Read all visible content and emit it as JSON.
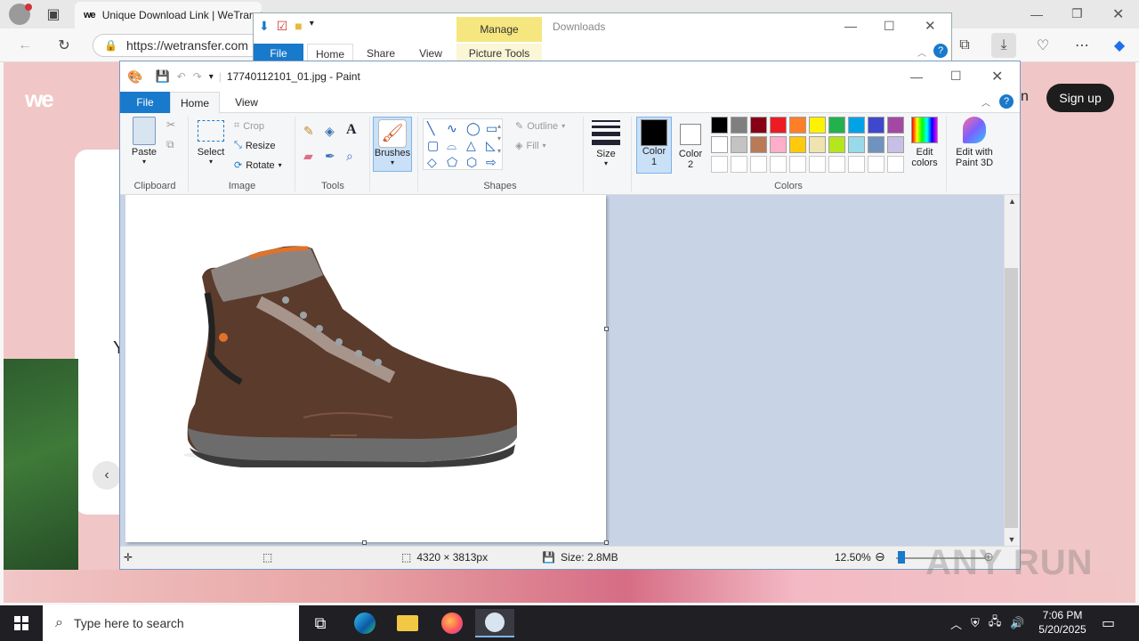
{
  "browser": {
    "tab_title": "Unique Download Link | WeTransfer",
    "tab_logo": "we",
    "url": "https://wetransfer.com",
    "icons": [
      "profile-icon",
      "tab-actions-icon",
      "back-icon",
      "refresh-icon",
      "lock-icon",
      "collections-icon",
      "downloads-icon",
      "health-icon",
      "more-icon",
      "copilot-icon"
    ]
  },
  "webpage": {
    "logo": "we",
    "signup_label": "Sign up",
    "partial_text_right": "n",
    "partial_text_left": "Y",
    "back_arrow": "‹"
  },
  "explorer": {
    "title": "Downloads",
    "manage_label": "Manage",
    "tabs": [
      "File",
      "Home",
      "Share",
      "View",
      "Picture Tools"
    ]
  },
  "paint": {
    "title": "17740112101_01.jpg - Paint",
    "tabs": {
      "file": "File",
      "home": "Home",
      "view": "View"
    },
    "clipboard": {
      "paste": "Paste",
      "label": "Clipboard"
    },
    "image": {
      "select": "Select",
      "crop": "Crop",
      "resize": "Resize",
      "rotate": "Rotate",
      "label": "Image"
    },
    "tools": {
      "label": "Tools"
    },
    "brushes": {
      "label": "Brushes"
    },
    "shapes": {
      "outline": "Outline",
      "fill": "Fill",
      "label": "Shapes"
    },
    "size": {
      "label": "Size"
    },
    "color1": {
      "label": "Color\n1",
      "line1": "Color",
      "line2": "1",
      "value": "#000000"
    },
    "color2": {
      "line1": "Color",
      "line2": "2",
      "value": "#ffffff"
    },
    "colors": {
      "label": "Colors",
      "row1": [
        "#000000",
        "#7f7f7f",
        "#880015",
        "#ed1c24",
        "#ff7f27",
        "#fff200",
        "#22b14c",
        "#00a2e8",
        "#3f48cc",
        "#a349a4"
      ],
      "row2": [
        "#ffffff",
        "#c3c3c3",
        "#b97a57",
        "#ffaec9",
        "#ffc90e",
        "#efe4b0",
        "#b5e61d",
        "#99d9ea",
        "#7092be",
        "#c8bfe7"
      ]
    },
    "edit_colors": {
      "line1": "Edit",
      "line2": "colors"
    },
    "edit_paint3d": {
      "line1": "Edit with",
      "line2": "Paint 3D"
    },
    "status": {
      "dimensions": "4320 × 3813px",
      "size": "Size: 2.8MB",
      "zoom": "12.50%"
    }
  },
  "taskbar": {
    "search_placeholder": "Type here to search",
    "apps": [
      "task-view-icon",
      "edge-icon",
      "file-explorer-icon",
      "firefox-icon",
      "paint-icon"
    ],
    "time": "7:06 PM",
    "date": "5/20/2025"
  },
  "watermark": "ANY RUN"
}
